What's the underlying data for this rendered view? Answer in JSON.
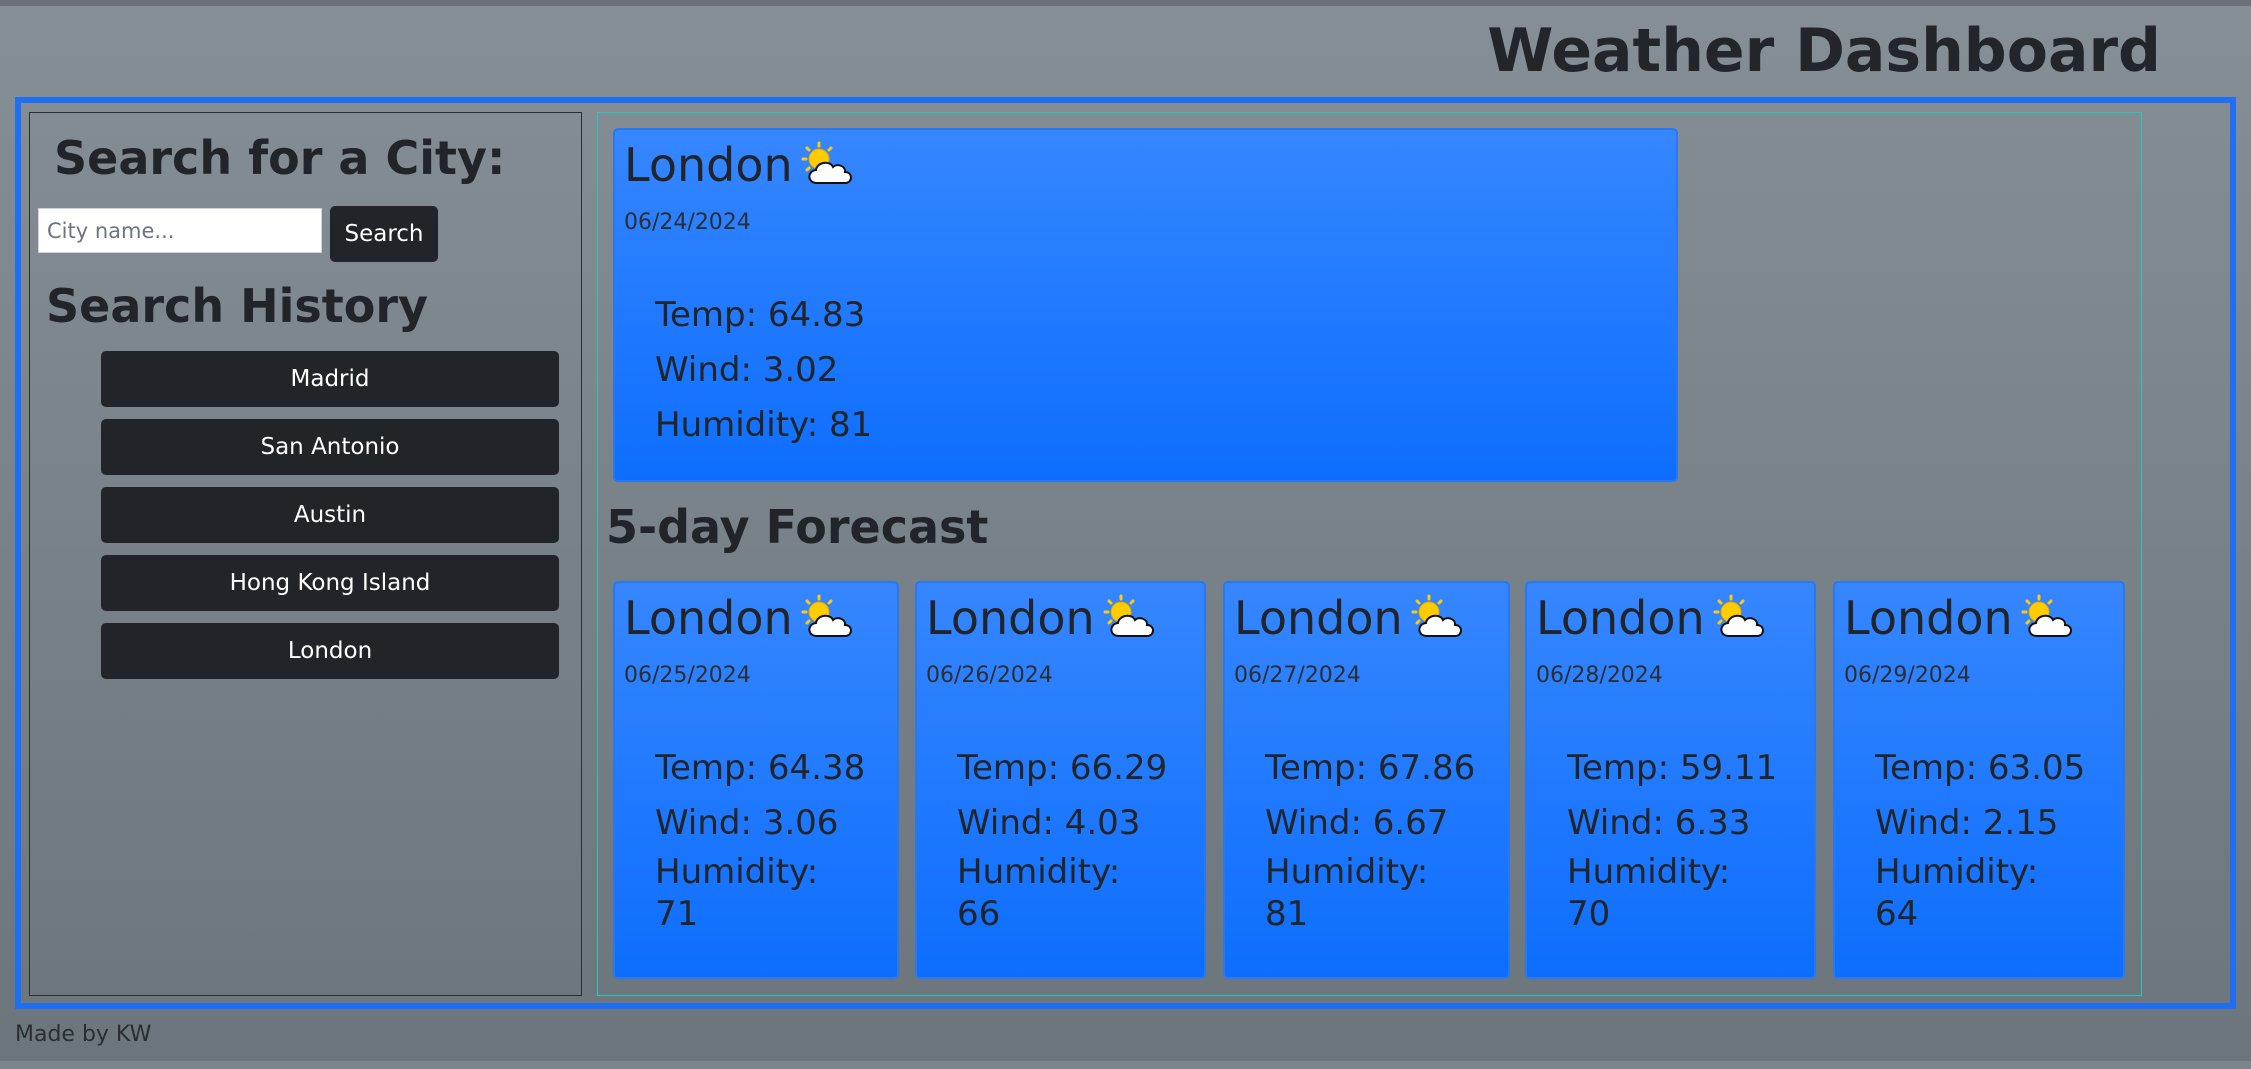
{
  "header": {
    "title": "Weather Dashboard"
  },
  "sidebar": {
    "search_heading": "Search for a City:",
    "search_placeholder": "City name...",
    "search_value": "",
    "search_button": "Search",
    "history_heading": "Search History",
    "history": [
      "Madrid",
      "San Antonio",
      "Austin",
      "Hong Kong Island",
      "London"
    ]
  },
  "current": {
    "city": "London",
    "icon": "partly-cloudy-icon",
    "date": "06/24/2024",
    "temp": "Temp: 64.83",
    "wind": "Wind: 3.02",
    "humidity": "Humidity: 81"
  },
  "forecast_heading": "5-day Forecast",
  "forecast": [
    {
      "city": "London",
      "icon": "partly-cloudy-icon",
      "date": "06/25/2024",
      "temp": "Temp: 64.38",
      "wind": "Wind: 3.06",
      "humidity": "Humidity: 71"
    },
    {
      "city": "London",
      "icon": "partly-cloudy-icon",
      "date": "06/26/2024",
      "temp": "Temp: 66.29",
      "wind": "Wind: 4.03",
      "humidity": "Humidity: 66"
    },
    {
      "city": "London",
      "icon": "partly-cloudy-icon",
      "date": "06/27/2024",
      "temp": "Temp: 67.86",
      "wind": "Wind: 6.67",
      "humidity": "Humidity: 81"
    },
    {
      "city": "London",
      "icon": "partly-cloudy-icon",
      "date": "06/28/2024",
      "temp": "Temp: 59.11",
      "wind": "Wind: 6.33",
      "humidity": "Humidity: 70"
    },
    {
      "city": "London",
      "icon": "partly-cloudy-icon",
      "date": "06/29/2024",
      "temp": "Temp: 63.05",
      "wind": "Wind: 2.15",
      "humidity": "Humidity: 64"
    }
  ],
  "footer": {
    "text": "Made by KW"
  },
  "colors": {
    "accent": "#0d6efd",
    "dark_button": "#212529",
    "border_blue": "#1f6ff5"
  }
}
